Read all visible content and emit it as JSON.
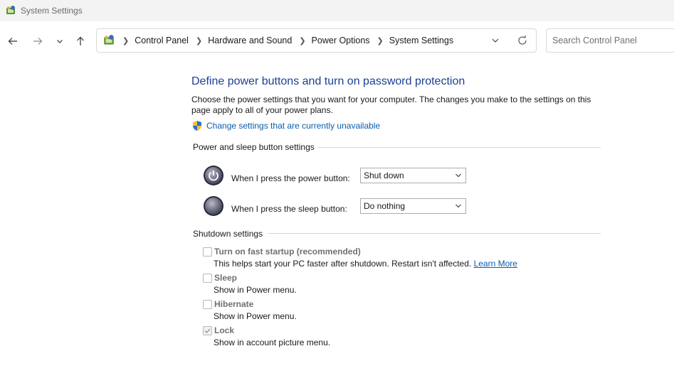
{
  "window": {
    "title": "System Settings"
  },
  "address_bar": {
    "breadcrumbs": [
      "Control Panel",
      "Hardware and Sound",
      "Power Options",
      "System Settings"
    ]
  },
  "search": {
    "placeholder": "Search Control Panel"
  },
  "page": {
    "heading": "Define power buttons and turn on password protection",
    "description": "Choose the power settings that you want for your computer. The changes you make to the settings on this page apply to all of your power plans.",
    "uac_link": "Change settings that are currently unavailable"
  },
  "power_sleep": {
    "group_title": "Power and sleep button settings",
    "power_button": {
      "label": "When I press the power button:",
      "value": "Shut down"
    },
    "sleep_button": {
      "label": "When I press the sleep button:",
      "value": "Do nothing"
    }
  },
  "shutdown": {
    "group_title": "Shutdown settings",
    "fast_startup": {
      "label": "Turn on fast startup (recommended)",
      "desc": "This helps start your PC faster after shutdown. Restart isn't affected.",
      "link": "Learn More",
      "checked": false
    },
    "sleep": {
      "label": "Sleep",
      "desc": "Show in Power menu.",
      "checked": false
    },
    "hibernate": {
      "label": "Hibernate",
      "desc": "Show in Power menu.",
      "checked": false
    },
    "lock": {
      "label": "Lock",
      "desc": "Show in account picture menu.",
      "checked": true
    }
  },
  "colors": {
    "heading": "#1c3f94",
    "link": "#0b5cad",
    "disabled_text": "#707070"
  },
  "icons": [
    "control-panel-icon",
    "back-arrow-icon",
    "forward-arrow-icon",
    "recent-dropdown-icon",
    "up-arrow-icon",
    "chevron-right-icon",
    "chevron-down-icon",
    "refresh-icon",
    "uac-shield-icon",
    "power-button-icon",
    "sleep-button-icon",
    "checkmark-icon"
  ]
}
